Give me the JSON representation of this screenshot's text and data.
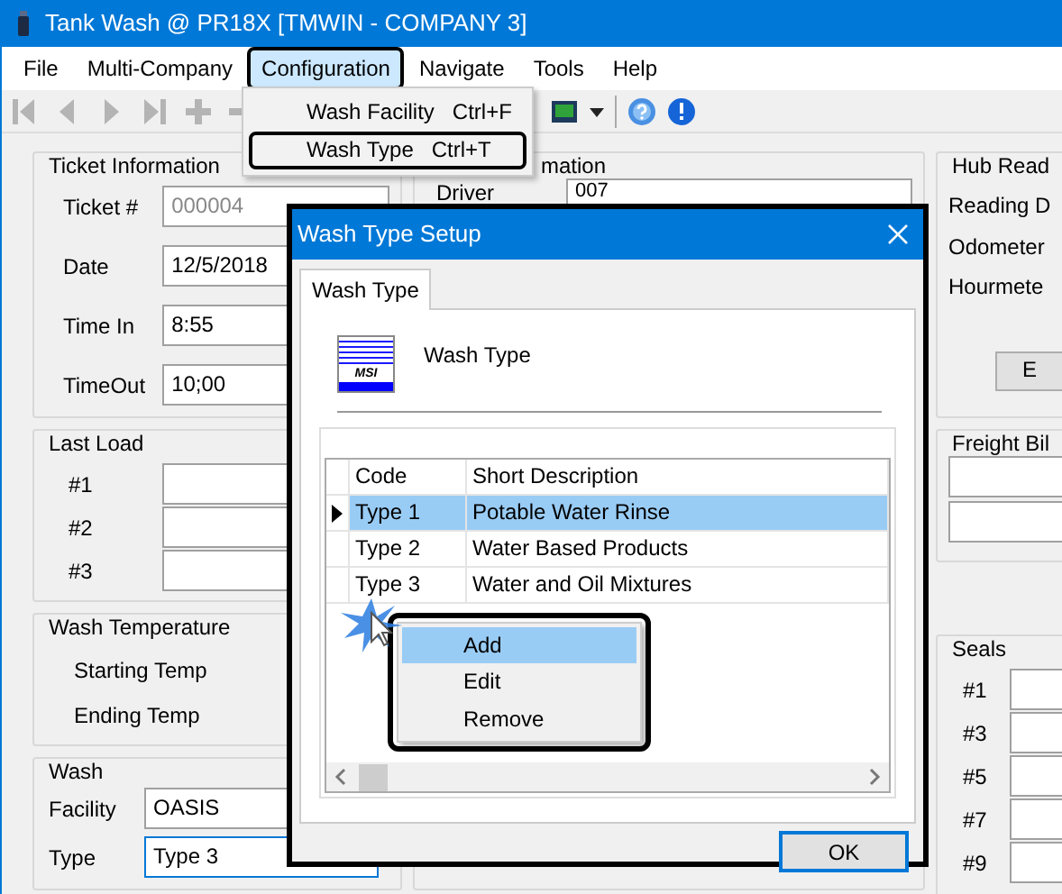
{
  "window": {
    "title": "Tank Wash @ PR18X [TMWIN - COMPANY 3]"
  },
  "menu_bar": [
    {
      "label": "File",
      "selected": false,
      "outlined": false
    },
    {
      "label": "Multi-Company",
      "selected": false,
      "outlined": false
    },
    {
      "label": "Configuration",
      "selected": true,
      "outlined": true
    },
    {
      "label": "Navigate",
      "selected": false,
      "outlined": false
    },
    {
      "label": "Tools",
      "selected": false,
      "outlined": false
    },
    {
      "label": "Help",
      "selected": false,
      "outlined": false
    }
  ],
  "open_menu": {
    "items": [
      {
        "label": "Wash Facility",
        "shortcut": "Ctrl+F",
        "outlined": false
      },
      {
        "label": "Wash Type",
        "shortcut": "Ctrl+T",
        "outlined": true
      }
    ]
  },
  "toolbar": [
    {
      "kind": "first",
      "disabled": true
    },
    {
      "kind": "previous",
      "disabled": true
    },
    {
      "kind": "next",
      "disabled": true
    },
    {
      "kind": "last",
      "disabled": true
    },
    {
      "kind": "add",
      "disabled": true
    },
    {
      "kind": "remove",
      "disabled": true
    },
    {
      "kind": "gap"
    },
    {
      "kind": "monitor",
      "disabled": false
    },
    {
      "kind": "caret",
      "disabled": false
    },
    {
      "kind": "separator"
    },
    {
      "kind": "help",
      "disabled": false
    },
    {
      "kind": "info",
      "disabled": false
    }
  ],
  "ticket_information": {
    "title": "Ticket Information",
    "fields": [
      {
        "label": "Ticket #",
        "value": "000004",
        "disabled": true
      },
      {
        "label": "Date",
        "value": "12/5/2018",
        "disabled": false
      },
      {
        "label": "Time In",
        "value": "8:55",
        "disabled": false
      },
      {
        "label": "TimeOut",
        "value": "10;00",
        "disabled": false
      }
    ]
  },
  "last_load": {
    "title": "Last Load",
    "labels": [
      "#1",
      "#2",
      "#3"
    ]
  },
  "wash_temperature": {
    "title": "Wash Temperature",
    "labels": [
      "Starting Temp",
      "Ending Temp"
    ]
  },
  "wash": {
    "title": "Wash",
    "fields": [
      {
        "label": "Facility",
        "value": "OASIS",
        "focused": false
      },
      {
        "label": "Type",
        "value": "Type 3",
        "focused": true
      }
    ]
  },
  "driver_information": {
    "title": "mation",
    "label": "Driver",
    "value": "007"
  },
  "hub_readings": {
    "title": "Hub Read",
    "labels": [
      "Reading D",
      "Odometer",
      "Hourmete"
    ],
    "button": "E"
  },
  "freight_bills": {
    "title": "Freight Bil"
  },
  "seals": {
    "title": "Seals",
    "labels": [
      "#1",
      "#3",
      "#5",
      "#7",
      "#9"
    ]
  },
  "dialog": {
    "title": "Wash Type Setup",
    "outlined": true,
    "tabs": [
      {
        "label": "Wash Type",
        "selected": true
      }
    ],
    "logo_text": "MSI",
    "heading": "Wash Type",
    "grid": {
      "columns": [
        "Code",
        "Short Description"
      ],
      "rows": [
        {
          "cells": [
            "Type 1",
            "Potable Water Rinse"
          ],
          "selected": true
        },
        {
          "cells": [
            "Type 2",
            "Water Based Products"
          ],
          "selected": false
        },
        {
          "cells": [
            "Type 3",
            "Water and Oil Mixtures"
          ],
          "selected": false
        }
      ]
    },
    "buttons": [
      {
        "label": "OK",
        "default": true
      }
    ]
  },
  "context_menu": {
    "outlined": true,
    "items": [
      {
        "label": "Add",
        "highlighted": true
      },
      {
        "label": "Edit",
        "highlighted": false
      },
      {
        "label": "Remove",
        "highlighted": false
      }
    ]
  }
}
